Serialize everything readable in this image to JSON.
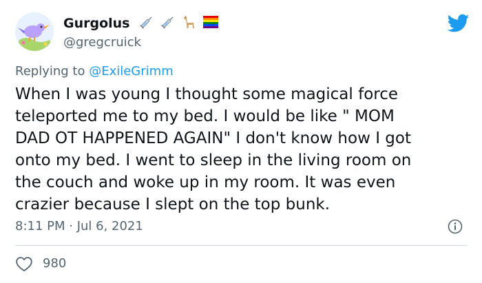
{
  "author": {
    "display_name": "Gurgolus",
    "handle": "@gregcruick",
    "badges": [
      "syringe-icon",
      "syringe-icon",
      "llama-icon",
      "rainbow-flag-icon"
    ]
  },
  "reply": {
    "prefix": "Replying to ",
    "mention": "@ExileGrimm"
  },
  "tweet": {
    "text": "When I was young I thought some magical force\nteleported me to my bed. I would be like \" MOM\nDAD OT HAPPENED AGAIN\" I don't know how I got\nonto my bed. I went to sleep in the living room on\nthe couch and woke up in my room. It was even\ncrazier because I slept on the top bunk.",
    "timestamp": "8:11 PM · Jul 6, 2021"
  },
  "engagement": {
    "likes": "980"
  },
  "colors": {
    "accent": "#1d9bf0",
    "secondary_text": "#536471",
    "heart": "#536471"
  }
}
